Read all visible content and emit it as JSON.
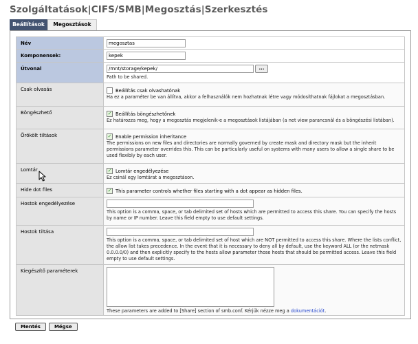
{
  "title": "Szolgáltatások|CIFS/SMB|Megosztás|Szerkesztés",
  "tabs": [
    {
      "label": "Beállítások",
      "active": true
    },
    {
      "label": "Megosztások",
      "active": false
    }
  ],
  "rows": {
    "name": {
      "label": "Név",
      "value": "megosztas"
    },
    "component": {
      "label": "Komponensek:",
      "value": "kepek"
    },
    "path": {
      "label": "Útvonal",
      "value": "/mnt/storage/kepek/",
      "browse_label": "...",
      "help": "Path to be shared."
    },
    "readonly": {
      "label": "Csak olvasás",
      "checkbox_label": "Beállítás csak olvashatónak",
      "checked": false,
      "help": "Ha ez a paraméter be van állítva, akkor a felhasználók nem hozhatnak létre vagy módosíthatnak fájlokat a megosztásban."
    },
    "browsable": {
      "label": "Böngészhető",
      "checkbox_label": "Beállítás böngészhetőnek",
      "checked": true,
      "help": "Ez határozza meg, hogy a megosztás megjelenik-e a megosztások listájában (a net view parancsnál és a böngészési listában)."
    },
    "inherit": {
      "label": "Örökölt tiltások",
      "checkbox_label": "Enable permission inheritance",
      "checked": true,
      "help": "The permissions on new files and directories are normally governed by create mask and directory mask but the inherit permissions parameter overrides this. This can be particularly useful on systems with many users to allow a single share to be used flexibly by each user."
    },
    "recycle": {
      "label": "Lomtár",
      "checkbox_label": "Lomtár engedélyezése",
      "checked": true,
      "help": "Ez csinál egy lomtárat a megosztáson."
    },
    "hidedot": {
      "label": "Hide dot files",
      "checkbox_label": "This parameter controls whether files starting with a dot appear as hidden files.",
      "checked": true
    },
    "hostsallow": {
      "label": "Hostok engedélyezése",
      "value": "",
      "help": "This option is a comma, space, or tab delimited set of hosts which are permitted to access this share. You can specify the hosts by name or IP number. Leave this field empty to use default settings."
    },
    "hostsdeny": {
      "label": "Hostok tiltása",
      "value": "",
      "help": "This option is a comma, space, or tab delimited set of host which are NOT permitted to access this share. Where the lists conflict, the allow list takes precedence. In the event that it is necessary to deny all by default, use the keyword ALL (or the netmask 0.0.0.0/0) and then explicitly specify to the hosts allow parameter those hosts that should be permitted access. Leave this field empty to use default settings."
    },
    "auxparams": {
      "label": "Kiegészítő paraméterek",
      "value": "",
      "help_prefix": "These parameters are added to [Share] section of smb.conf. Kérjük nézze meg a ",
      "help_link": "dokumentációt",
      "help_suffix": "."
    }
  },
  "buttons": {
    "save": "Mentés",
    "cancel": "Mégse"
  },
  "colors": {
    "tab_active": "#435370",
    "required_label_bg": "#bbc8e0",
    "optional_label_bg": "#e4e4e4",
    "link": "#2244cc",
    "check": "#2c8a2c"
  }
}
